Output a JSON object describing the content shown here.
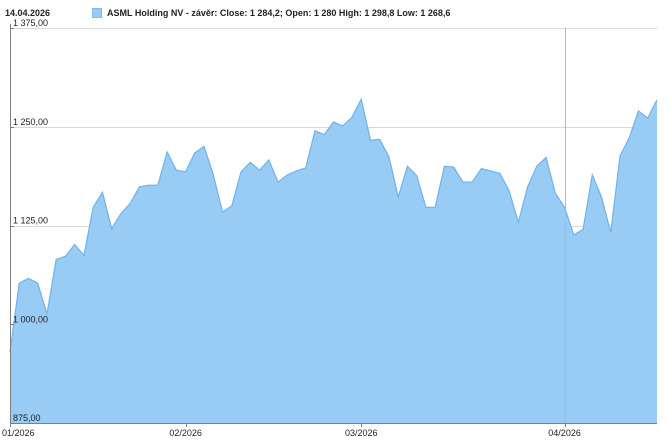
{
  "header": {
    "date": "14.04.2026",
    "legend_label": "ASML Holding NV - závěr: Close: 1 284,2; Open: 1 280 High: 1 298,8 Low: 1 268,6"
  },
  "colors": {
    "fill": "#99ccf5",
    "line": "#6fb3ea",
    "grid": "#d9d9d9",
    "axis": "#7f7f7f",
    "cursor": "#b8b8b8"
  },
  "chart_data": {
    "type": "area",
    "title": "",
    "series": [
      {
        "name": "ASML Holding NV - závěr",
        "values": [
          965,
          1052,
          1058,
          1052,
          1013,
          1082,
          1086,
          1101,
          1087,
          1148,
          1167,
          1121,
          1140,
          1153,
          1174,
          1176,
          1176,
          1218,
          1195,
          1193,
          1217,
          1225,
          1189,
          1142,
          1150,
          1193,
          1205,
          1195,
          1208,
          1180,
          1189,
          1194,
          1198,
          1245,
          1240,
          1256,
          1251,
          1262,
          1285,
          1233,
          1234,
          1212,
          1161,
          1200,
          1188,
          1148,
          1148,
          1200,
          1199,
          1180,
          1180,
          1197,
          1194,
          1191,
          1169,
          1129,
          1174,
          1200,
          1211,
          1166,
          1148,
          1113,
          1120,
          1189,
          1161,
          1116,
          1213,
          1236,
          1270,
          1261,
          1284.2
        ]
      }
    ],
    "yticks": [
      {
        "value": 875,
        "label": "875,00"
      },
      {
        "value": 1000,
        "label": "1 000,00"
      },
      {
        "value": 1125,
        "label": "1 125,00"
      },
      {
        "value": 1250,
        "label": "1 250,00"
      },
      {
        "value": 1375,
        "label": "1 375,00"
      }
    ],
    "xticks": [
      {
        "index": 0,
        "label": "01/2026"
      },
      {
        "index": 19,
        "label": "02/2026"
      },
      {
        "index": 38,
        "label": "03/2026"
      },
      {
        "index": 60,
        "label": "04/2026"
      }
    ],
    "ylim": [
      875,
      1375
    ],
    "grid": true,
    "legend_position": "top-left",
    "cursor_index": 60
  }
}
